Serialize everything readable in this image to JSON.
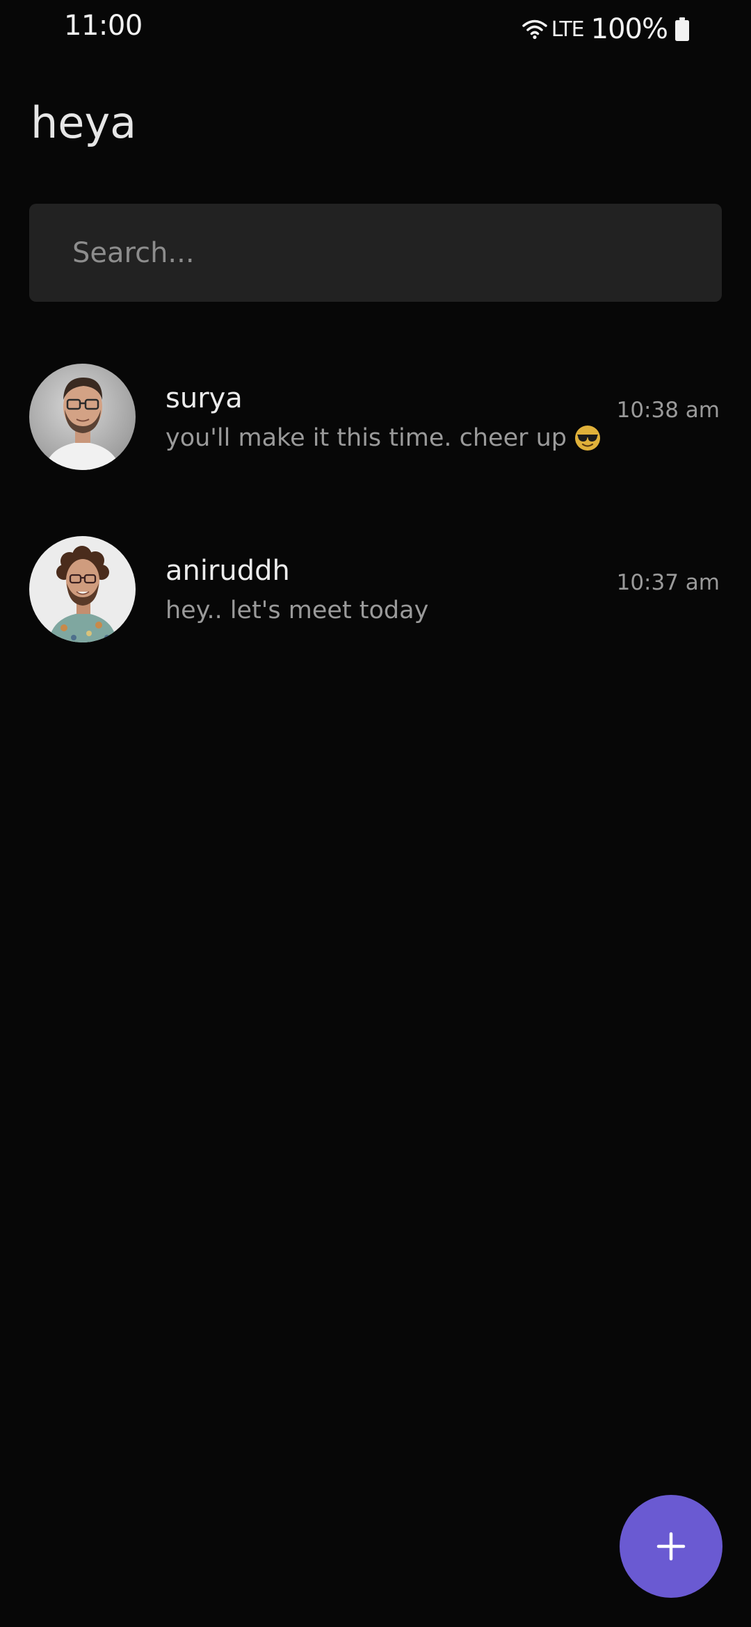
{
  "status_bar": {
    "time": "11:00",
    "network": "LTE",
    "battery": "100%",
    "icons": [
      "wifi-icon",
      "battery-icon"
    ]
  },
  "app": {
    "title": "heya"
  },
  "search": {
    "placeholder": "Search...",
    "value": ""
  },
  "chats": [
    {
      "name": "surya",
      "preview": "you'll make it this time. cheer up",
      "preview_emoji": "sunglasses-emoji-icon",
      "time": "10:38 am"
    },
    {
      "name": "aniruddh",
      "preview": "hey.. let's meet today",
      "time": "10:37 am"
    }
  ],
  "fab": {
    "icon": "plus-icon",
    "color": "#6a5ad2"
  },
  "colors": {
    "background": "#070707",
    "search_background": "#222222",
    "accent": "#6a5ad2"
  }
}
